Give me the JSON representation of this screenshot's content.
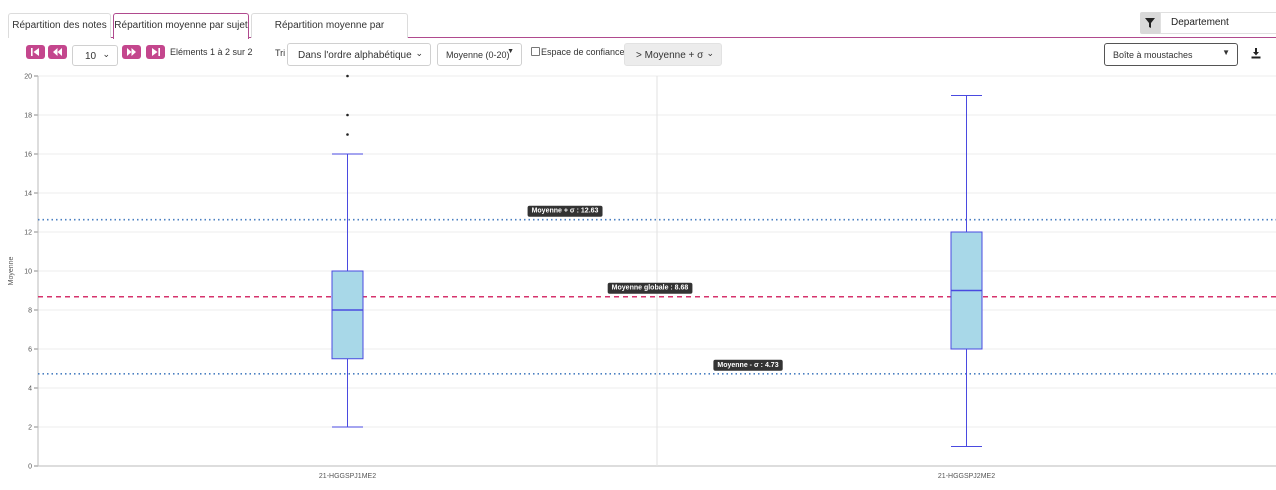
{
  "tabs": [
    {
      "label": "Répartition des notes",
      "active": false
    },
    {
      "label": "Répartition moyenne par sujet",
      "active": true
    },
    {
      "label": "Répartition moyenne par correcteur",
      "active": false
    }
  ],
  "filter": {
    "icon": "filter-icon",
    "value": "Departement"
  },
  "toolbar": {
    "page_size": "10",
    "elements_text": "Eléments 1 à 2 sur 2",
    "sort_label": "Tri",
    "sort_value": "Dans l'ordre alphabétique",
    "metric_value": "Moyenne (0-20)",
    "confidence_label": "Espace de confiance :",
    "confidence_value": "> Moyenne + σ",
    "chart_type_value": "Boîte à moustaches"
  },
  "colors": {
    "accent": "#c4468d",
    "box_fill": "#a8d8e8",
    "box_stroke": "#4a4ae0",
    "mean_line": "#d6336c",
    "sigma_line": "#4a7fc1",
    "label_bg": "#333333"
  },
  "chart_data": {
    "type": "boxplot",
    "ylabel": "Moyenne",
    "xlabel": "",
    "ylim": [
      0,
      20
    ],
    "yticks": [
      0,
      2,
      4,
      6,
      8,
      10,
      12,
      14,
      16,
      18,
      20
    ],
    "grid": true,
    "categories": [
      "21-HGGSPJ1ME2",
      "21-HGGSPJ2ME2"
    ],
    "boxes": [
      {
        "category": "21-HGGSPJ1ME2",
        "min": 2,
        "q1": 5.5,
        "median": 8,
        "q3": 10,
        "max": 16,
        "outliers": [
          17,
          18,
          20
        ]
      },
      {
        "category": "21-HGGSPJ2ME2",
        "min": 1,
        "q1": 6,
        "median": 9,
        "q3": 12,
        "max": 19,
        "outliers": []
      }
    ],
    "reference_lines": [
      {
        "label": "Moyenne + σ : 12.63",
        "value": 12.63,
        "style": "dotted",
        "role": "sigma"
      },
      {
        "label": "Moyenne globale : 8.68",
        "value": 8.68,
        "style": "dashed",
        "role": "mean"
      },
      {
        "label": "Moyenne - σ : 4.73",
        "value": 4.73,
        "style": "dotted",
        "role": "sigma"
      }
    ]
  }
}
